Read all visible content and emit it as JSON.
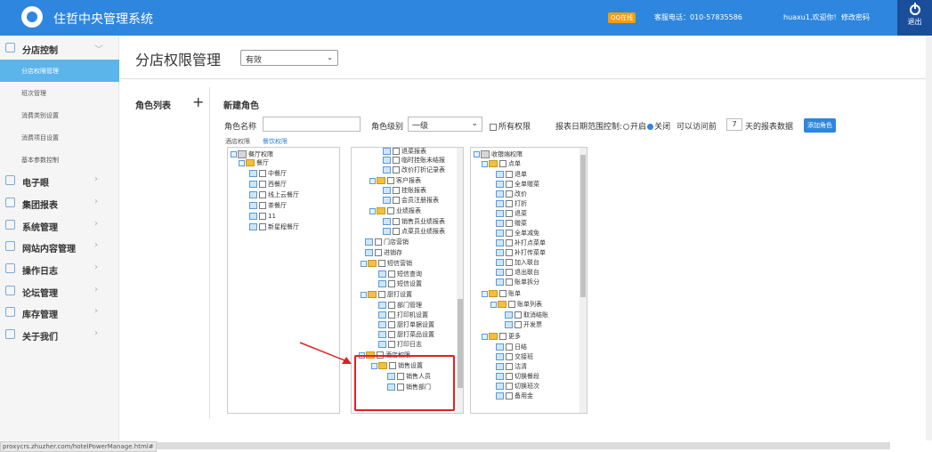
{
  "header": {
    "app_title": "住哲中央管理系统",
    "qq_label": "QQ在线",
    "phone": "客服电话：010-57835586",
    "user": "huaxu1,欢迎你!",
    "change_password": "修改密码",
    "logout": "退出"
  },
  "sidebar": {
    "groups": [
      {
        "label": "分店控制",
        "icon": "store-icon"
      },
      {
        "label": "电子眼",
        "icon": "monitor-icon"
      },
      {
        "label": "集团报表",
        "icon": "chart-icon"
      },
      {
        "label": "系统管理",
        "icon": "gear-icon"
      },
      {
        "label": "网站内容管理",
        "icon": "web-icon"
      },
      {
        "label": "操作日志",
        "icon": "log-icon"
      },
      {
        "label": "论坛管理",
        "icon": "forum-icon"
      },
      {
        "label": "库存管理",
        "icon": "inventory-icon"
      },
      {
        "label": "关于我们",
        "icon": "person-icon"
      }
    ],
    "sub_items": [
      "分店权限管理",
      "班次管理",
      "消费类别设置",
      "消费项目设置",
      "基本参数控制"
    ]
  },
  "main": {
    "page_title": "分店权限管理",
    "status_value": "有效",
    "role_list_title": "角色列表",
    "add_symbol": "+",
    "new_role_title": "新建角色",
    "role_name_label": "角色名称",
    "role_level_label": "角色级别",
    "role_level_value": "一级",
    "all_permissions": "所有权限",
    "report_range_label": "报表日期范围控制:",
    "radio_on": "开启",
    "radio_off": "关闭",
    "access_prefix": "可以访问前",
    "days_value": "7",
    "days_suffix": "天的报表数据",
    "add_role_button": "添加角色",
    "tab_hotel": "酒店权限",
    "tab_catering": "餐饮权限"
  },
  "tree_left": [
    "餐厅权限",
    "餐厅",
    "中餐厅",
    "西餐厅",
    "线上云餐厅",
    "茶餐厅",
    "11",
    "新星程餐厅"
  ],
  "tree_middle": [
    "退菜报表",
    "临时挂账未结报",
    "改价打折记录表",
    "客户报表",
    "挂账报表",
    "会员注册报表",
    "业绩报表",
    "销售员业绩报表",
    "点菜员业绩报表",
    "门店营销",
    "进销存",
    "短信营销",
    "短信查询",
    "短信设置",
    "厨打设置",
    "部门管理",
    "打印机设置",
    "厨打单据设置",
    "厨打菜品设置",
    "打印日志",
    "酒店权限",
    "销售设置",
    "销售人员",
    "销售部门"
  ],
  "tree_right": [
    "收银端权限",
    "点单",
    "退单",
    "全单赠菜",
    "改价",
    "打折",
    "退菜",
    "赠菜",
    "全单减免",
    "补打点菜单",
    "补打传菜单",
    "加入联台",
    "退出联台",
    "账单拆分",
    "账单",
    "账单列表",
    "取消结账",
    "开发票",
    "更多",
    "日结",
    "交接班",
    "沽清",
    "切换餐段",
    "切换班次",
    "备用金"
  ],
  "status_url": "proxycrs.zhuzher.com/hotelPowerManage.html#"
}
